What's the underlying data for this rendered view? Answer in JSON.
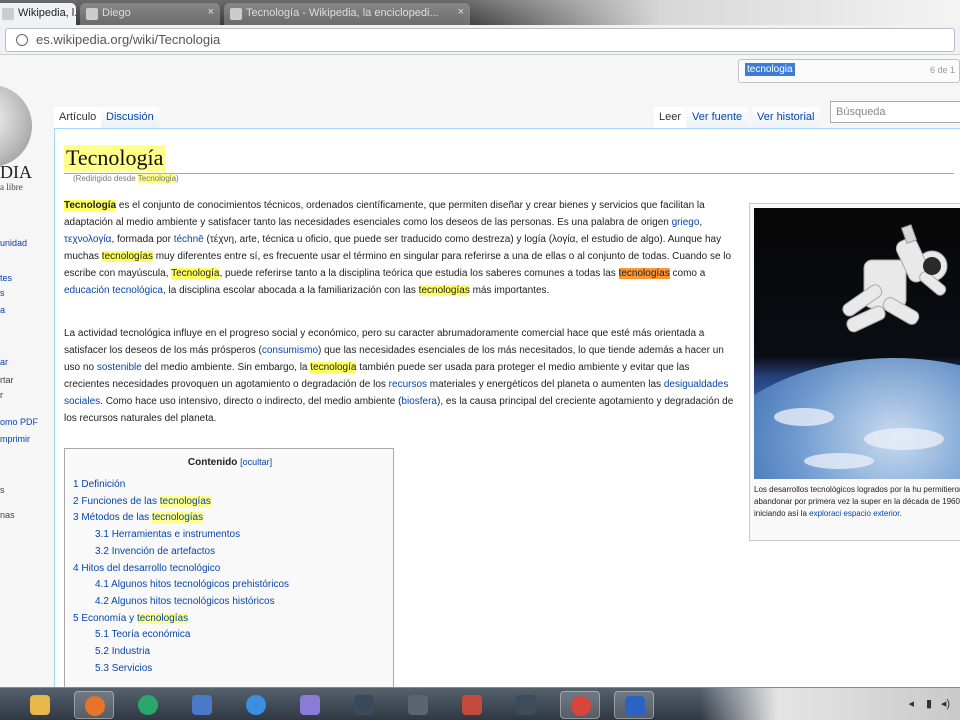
{
  "browser": {
    "tabs": [
      {
        "label": "Wikipedia, l..."
      },
      {
        "label": "Diego"
      },
      {
        "label": "Tecnología - Wikipedia, la enciclopedi..."
      }
    ],
    "url": "es.wikipedia.org/wiki/Tecnologia",
    "find": {
      "query": "tecnologia",
      "count": "6 de 1"
    }
  },
  "sidebar": {
    "logo_text": "DIA",
    "logo_sub": "a libre",
    "items": [
      {
        "label": "unidad",
        "link": true
      },
      {
        "label": "tes",
        "link": true
      },
      {
        "label": "s",
        "link": true
      },
      {
        "label": "a",
        "link": true
      },
      {
        "label": "ar",
        "link": true
      },
      {
        "label": "rtar",
        "link": false
      },
      {
        "label": "r",
        "link": true
      },
      {
        "label": "omo PDF",
        "link": true
      },
      {
        "label": "mprimir",
        "link": true
      },
      {
        "label": "s",
        "link": false
      },
      {
        "label": "nas",
        "link": false
      }
    ]
  },
  "wiki": {
    "tabs": {
      "article": "Artículo",
      "discussion": "Discusión",
      "read": "Leer",
      "view_source": "Ver fuente",
      "view_history": "Ver historial"
    },
    "search_placeholder": "Búsqueda",
    "title": "Tecnología",
    "redirect": {
      "prefix": "(Redirigido desde ",
      "term": "Tecnologia",
      "suffix": ")"
    },
    "paragraphs": [
      [
        {
          "t": "Tecnología",
          "s": "hl-bold"
        },
        {
          "t": " es el conjunto de conocimientos técnicos, ordenados científicamente, que permiten diseñar y crear bienes y servicios que facilitan la adaptación al medio ambiente y satisfacer tanto las necesidades esenciales como los deseos de las personas. Es una palabra de origen "
        },
        {
          "t": "griego",
          "s": "link"
        },
        {
          "t": ", "
        },
        {
          "t": "τεχνολογία",
          "s": "link"
        },
        {
          "t": ", formada por "
        },
        {
          "t": "téchnē",
          "s": "link"
        },
        {
          "t": " (τέχνη, arte, técnica u oficio, que puede ser traducido como destreza) y logía (λογία, el estudio de algo). Aunque hay muchas "
        },
        {
          "t": "tecnologías",
          "s": "hl"
        },
        {
          "t": " muy diferentes entre sí, es frecuente usar el término en singular para referirse a una de ellas o al conjunto de todas. Cuando se lo escribe con mayúscula, "
        },
        {
          "t": "Tecnología",
          "s": "hl"
        },
        {
          "t": ", puede referirse tanto a la disciplina teórica que estudia los saberes comunes a todas las "
        },
        {
          "t": "tecnologías",
          "s": "hl-cur"
        },
        {
          "t": " como a "
        },
        {
          "t": "educación tecnológica",
          "s": "link"
        },
        {
          "t": ", la disciplina escolar abocada a la familiarización con las "
        },
        {
          "t": "tecnologías",
          "s": "hl"
        },
        {
          "t": " más importantes."
        }
      ],
      [
        {
          "t": "La actividad tecnológica influye en el progreso social y económico, pero su caracter abrumadoramente comercial hace que esté más orientada a satisfacer los deseos de los más prósperos ("
        },
        {
          "t": "consumismo",
          "s": "link"
        },
        {
          "t": ") que las necesidades esenciales de los más necesitados, lo que tiende además a hacer un uso no "
        },
        {
          "t": "sostenible",
          "s": "link"
        },
        {
          "t": " del medio ambiente. Sin embargo, la "
        },
        {
          "t": "tecnología",
          "s": "hl"
        },
        {
          "t": " también puede ser usada para proteger el medio ambiente y evitar que las crecientes necesidades provoquen un agotamiento o degradación de los "
        },
        {
          "t": "recursos",
          "s": "link"
        },
        {
          "t": " materiales y energéticos del planeta o aumenten las "
        },
        {
          "t": "desigualdades sociales",
          "s": "link"
        },
        {
          "t": ". Como hace uso intensivo, directo o indirecto, del medio ambiente ("
        },
        {
          "t": "biosfera",
          "s": "link"
        },
        {
          "t": "), es la causa principal del creciente agotamiento y degradación de los recursos naturales del planeta."
        }
      ]
    ],
    "toc": {
      "title": "Contenido",
      "toggle": "[ocultar]",
      "items": [
        {
          "num": "1",
          "pre": "Definición",
          "hl": "",
          "post": "",
          "level": 1
        },
        {
          "num": "2",
          "pre": "Funciones de las ",
          "hl": "tecnologías",
          "post": "",
          "level": 1
        },
        {
          "num": "3",
          "pre": "Métodos de las ",
          "hl": "tecnologías",
          "post": "",
          "level": 1
        },
        {
          "num": "3.1",
          "pre": "Herramientas e instrumentos",
          "hl": "",
          "post": "",
          "level": 2
        },
        {
          "num": "3.2",
          "pre": "Invención de artefactos",
          "hl": "",
          "post": "",
          "level": 2
        },
        {
          "num": "4",
          "pre": "Hitos del desarrollo tecnológico",
          "hl": "",
          "post": "",
          "level": 1
        },
        {
          "num": "4.1",
          "pre": "Algunos hitos tecnológicos prehistóricos",
          "hl": "",
          "post": "",
          "level": 2
        },
        {
          "num": "4.2",
          "pre": "Algunos hitos tecnológicos históricos",
          "hl": "",
          "post": "",
          "level": 2
        },
        {
          "num": "5",
          "pre": "Economía y ",
          "hl": "tecnologías",
          "post": "",
          "level": 1
        },
        {
          "num": "5.1",
          "pre": "Teoría económica",
          "hl": "",
          "post": "",
          "level": 2
        },
        {
          "num": "5.2",
          "pre": "Industria",
          "hl": "",
          "post": "",
          "level": 2
        },
        {
          "num": "5.3",
          "pre": "Servicios",
          "hl": "",
          "post": "",
          "level": 2
        }
      ]
    },
    "thumb_caption": [
      {
        "t": "Los desarrollos tecnológicos logrados por la hu permitieron abandonar por primera vez la super en la década de 1960, iniciando así la "
      },
      {
        "t": "exploraci espacio exterior",
        "s": "link"
      },
      {
        "t": "."
      }
    ]
  },
  "colors": {
    "link": "#0645ad",
    "highlight": "#ffff5f",
    "highlight_current": "#ff9632",
    "content_border": "#a7d7f9"
  },
  "taskbar": {
    "apps": [
      {
        "icon": "explorer-folder-icon",
        "color": "#e6b84a"
      },
      {
        "icon": "firefox-icon",
        "color": "#e8742b"
      },
      {
        "icon": "green-circle-app-icon",
        "color": "#2aa86b"
      },
      {
        "icon": "document-app-icon",
        "color": "#4a79c8"
      },
      {
        "icon": "internet-explorer-icon",
        "color": "#3a8fe0"
      },
      {
        "icon": "link-app-icon",
        "color": "#8a7bd6"
      },
      {
        "icon": "steam-icon",
        "color": "#3a4a5a"
      },
      {
        "icon": "archive-app-icon",
        "color": "#5c6470"
      },
      {
        "icon": "cube-app-icon",
        "color": "#c54a3c"
      },
      {
        "icon": "media-app-icon",
        "color": "#3e4b5a"
      },
      {
        "icon": "chrome-icon",
        "color": "#d9453a"
      },
      {
        "icon": "window-app-icon",
        "color": "#2e62c2"
      }
    ]
  }
}
